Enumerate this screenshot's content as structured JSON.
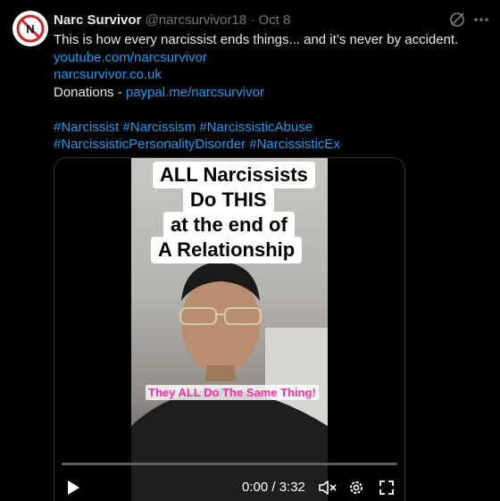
{
  "author": {
    "name": "Narc Survivor",
    "handle": "@narcsurvivor18",
    "separator": "·",
    "date": "Oct 8"
  },
  "tweet": {
    "text": "This is how every narcissist ends things... and it’s never by accident.",
    "link_youtube": "youtube.com/narcsurvivor",
    "link_site": "narcsurvivor.co.uk",
    "donations_label": "Donations - ",
    "link_paypal": "paypal.me/narcsurvivor",
    "hashtags_line1": "#Narcissist #Narcissism #NarcissisticAbuse",
    "hashtags_line2": "#NarcissisticPersonalityDisorder #NarcissisticEx"
  },
  "video": {
    "caption_lines": [
      "ALL Narcissists",
      "Do THIS",
      "at the end of",
      "A Relationship"
    ],
    "subtitle": "They ALL Do The Same Thing!",
    "time_display": "0:00 / 3:32",
    "progress_fraction": 0.0
  },
  "icons": {
    "grok": "grok-icon",
    "more": "more-icon",
    "play": "play-icon",
    "mute": "mute-icon",
    "settings": "settings-icon",
    "fullscreen": "fullscreen-icon"
  },
  "colors": {
    "background": "#000000",
    "link": "#1d9bf0",
    "muted": "#71767b",
    "subtitle": "#ff2aa0"
  }
}
